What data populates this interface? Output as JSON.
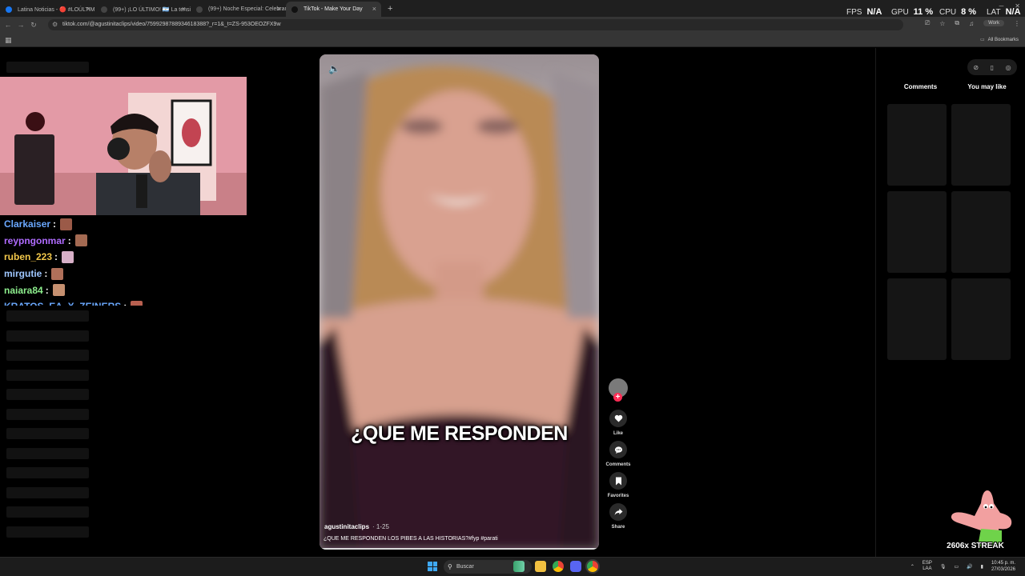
{
  "browser": {
    "tabs": [
      {
        "title": "Latina Noticias - 🔴 #LOÚLTIM",
        "favicon_color": "#1877f2",
        "active": false
      },
      {
        "title": "(99+) ¡LO ÚLTIMO! 🇦🇷 La tensió",
        "favicon_color": "#444444",
        "active": false
      },
      {
        "title": "(99+) Noche Especial: Celebran",
        "favicon_color": "#444444",
        "active": false
      },
      {
        "title": "TikTok - Make Your Day",
        "favicon_color": "#111111",
        "active": true
      }
    ],
    "new_tab": "+",
    "url": "tiktok.com/@agustinitaclips/video/7599298788934618388?_r=1&_t=ZS-953OEOZFX9w",
    "profile": "Work",
    "all_bookmarks": "All Bookmarks"
  },
  "hud": {
    "fps_label": "FPS",
    "fps_value": "N/A",
    "gpu_label": "GPU",
    "gpu_value": "11 %",
    "cpu_label": "CPU",
    "cpu_value": "8 %",
    "lat_label": "LAT",
    "lat_value": "N/A"
  },
  "chat": [
    {
      "user": "Clarkaiser",
      "color": "#6aa8ff",
      "emote": "#9b5a48"
    },
    {
      "user": "reypngonmar",
      "color": "#b06cff",
      "emote": "#a46a52"
    },
    {
      "user": "ruben_223",
      "color": "#f3c84b",
      "emote": "#d8b0c8"
    },
    {
      "user": "mirgutie",
      "color": "#9fc7ff",
      "emote": "#b0705a"
    },
    {
      "user": "naiara84",
      "color": "#8ef08e",
      "emote": "#c69070"
    },
    {
      "user": "KRATOS_EA_X_ZEINERS",
      "color": "#6aa8ff",
      "emote": "#b86050"
    }
  ],
  "video": {
    "caption": "¿QUE ME RESPONDEN",
    "username": "agustinitaclips",
    "date": "· 1-25",
    "description": "¿QUE ME RESPONDEN LOS PIBES A LAS HISTORIAS?#fyp #parati",
    "progress": 0.99
  },
  "actions": {
    "follow": "+",
    "like": "Like",
    "comments": "Comments",
    "favorites": "Favorites",
    "share": "Share"
  },
  "right_panel": {
    "tab_comments": "Comments",
    "tab_you_may_like": "You may like"
  },
  "streak": "2606x STREAK",
  "taskbar": {
    "search_placeholder": "Buscar",
    "lang_1": "ESP",
    "lang_2": "LAA",
    "time": "10:45 p. m.",
    "date": "27/03/2026"
  }
}
